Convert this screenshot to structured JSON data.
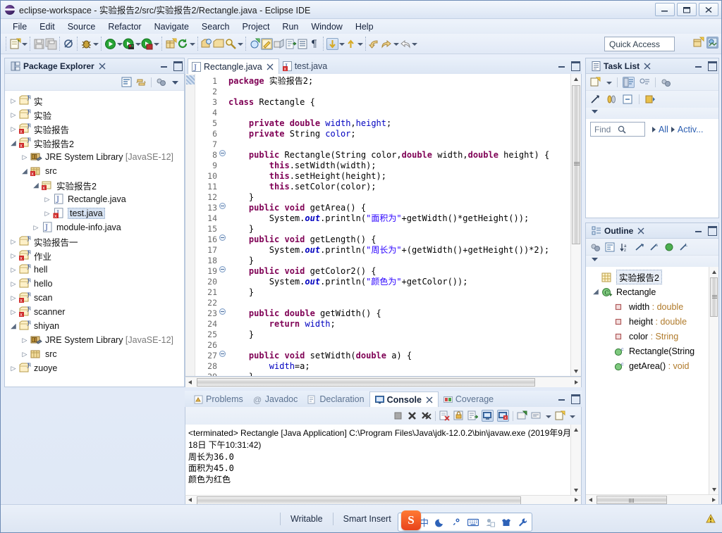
{
  "window": {
    "title": "eclipse-workspace - 实验报告2/src/实验报告2/Rectangle.java - Eclipse IDE",
    "minimize_label": "—",
    "maximize_label": "❐",
    "close_label": "✕"
  },
  "menubar": {
    "items": [
      "File",
      "Edit",
      "Source",
      "Refactor",
      "Navigate",
      "Search",
      "Project",
      "Run",
      "Window",
      "Help"
    ]
  },
  "toolbar": {
    "quick_access_placeholder": "Quick Access",
    "icons": [
      "new-wizard-icon",
      "new-dropdown-arrow",
      "save-icon",
      "save-all-icon",
      "toggle-breakpoint-icon",
      "debug-icon",
      "debug-dropdown-arrow",
      "run-icon",
      "run-dropdown-arrow",
      "run-coverage-icon",
      "coverage-dropdown-arrow",
      "external-tools-icon",
      "external-tools-dropdown-arrow",
      "new-java-package-icon",
      "refresh-icon",
      "refresh-dropdown-arrow",
      "open-type-icon",
      "open-task-icon",
      "search-icon",
      "search-dropdown-arrow",
      "new-java-class-icon",
      "java-editor-icon",
      "link-with-editor-icon",
      "open-declaration-icon",
      "show-whitespace-icon",
      "paragraph-mark-icon",
      "next-annotation-icon",
      "next-annotation-arrow",
      "previous-annotation-icon",
      "previous-annotation-arrow",
      "back-icon",
      "forward-icon",
      "forward-dropdown-arrow",
      "next-edit-icon",
      "next-edit-arrow"
    ],
    "perspective_icons": [
      "open-perspective-icon",
      "java-perspective-icon"
    ]
  },
  "package_explorer": {
    "title": "Package Explorer",
    "close_label": "✕",
    "toolbar_icons": [
      "collapse-all-icon",
      "link-with-editor-icon",
      "focus-on-active-task-icon",
      "view-menu-icon"
    ],
    "tree": [
      {
        "depth": 0,
        "twist": "closed",
        "icon": "java-project-icon",
        "label": "实",
        "error": false
      },
      {
        "depth": 0,
        "twist": "closed",
        "icon": "java-project-icon",
        "label": "实验",
        "error": false
      },
      {
        "depth": 0,
        "twist": "closed",
        "icon": "java-project-icon",
        "label": "实验报告",
        "error": true
      },
      {
        "depth": 0,
        "twist": "open",
        "icon": "java-project-icon",
        "label": "实验报告2",
        "error": true
      },
      {
        "depth": 1,
        "twist": "closed",
        "icon": "jre-library-icon",
        "label": "JRE System Library",
        "suffix": "[JavaSE-12]"
      },
      {
        "depth": 1,
        "twist": "open",
        "icon": "source-folder-icon",
        "label": "src",
        "error": true
      },
      {
        "depth": 2,
        "twist": "open",
        "icon": "package-icon",
        "label": "实验报告2",
        "error": true
      },
      {
        "depth": 3,
        "twist": "closed",
        "icon": "java-file-icon",
        "label": "Rectangle.java",
        "error": false
      },
      {
        "depth": 3,
        "twist": "closed",
        "icon": "java-file-icon",
        "label": "test.java",
        "error": true,
        "selected": true
      },
      {
        "depth": 2,
        "twist": "closed",
        "icon": "java-file-icon",
        "label": "module-info.java",
        "error": false
      },
      {
        "depth": 0,
        "twist": "closed",
        "icon": "java-project-icon",
        "label": "实验报告一",
        "error": false
      },
      {
        "depth": 0,
        "twist": "closed",
        "icon": "java-project-icon",
        "label": "作业",
        "error": true
      },
      {
        "depth": 0,
        "twist": "closed",
        "icon": "java-project-icon",
        "label": "hell",
        "error": false
      },
      {
        "depth": 0,
        "twist": "closed",
        "icon": "java-project-icon",
        "label": "hello",
        "error": false
      },
      {
        "depth": 0,
        "twist": "closed",
        "icon": "java-project-icon",
        "label": "scan",
        "error": true
      },
      {
        "depth": 0,
        "twist": "closed",
        "icon": "java-project-icon",
        "label": "scanner",
        "error": true
      },
      {
        "depth": 0,
        "twist": "open",
        "icon": "java-project-icon",
        "label": "shiyan",
        "error": false
      },
      {
        "depth": 1,
        "twist": "closed",
        "icon": "jre-library-icon",
        "label": "JRE System Library",
        "suffix": "[JavaSE-12]"
      },
      {
        "depth": 1,
        "twist": "closed",
        "icon": "source-folder-icon",
        "label": "src",
        "error": false
      },
      {
        "depth": 0,
        "twist": "closed",
        "icon": "java-project-icon",
        "label": "zuoye",
        "error": false
      }
    ]
  },
  "editor": {
    "tabs": [
      {
        "label": "Rectangle.java",
        "active": true,
        "close_label": "✕",
        "icon": "java-file-icon"
      },
      {
        "label": "test.java",
        "active": false,
        "icon": "java-file-error-icon"
      }
    ],
    "first_line": 1,
    "lines": [
      {
        "n": 1,
        "fold": false,
        "tokens": [
          {
            "t": "package ",
            "c": "kw"
          },
          {
            "t": "实验报告2;",
            "c": ""
          }
        ]
      },
      {
        "n": 2,
        "fold": false,
        "tokens": []
      },
      {
        "n": 3,
        "fold": false,
        "tokens": [
          {
            "t": "class",
            "c": "kw"
          },
          {
            "t": " Rectangle {",
            "c": ""
          }
        ]
      },
      {
        "n": 4,
        "fold": false,
        "tokens": []
      },
      {
        "n": 5,
        "fold": false,
        "tokens": [
          {
            "t": "    ",
            "c": ""
          },
          {
            "t": "private double",
            "c": "kw"
          },
          {
            "t": " ",
            "c": ""
          },
          {
            "t": "width",
            "c": "fld"
          },
          {
            "t": ",",
            "c": ""
          },
          {
            "t": "height",
            "c": "fld"
          },
          {
            "t": ";",
            "c": ""
          }
        ]
      },
      {
        "n": 6,
        "fold": false,
        "tokens": [
          {
            "t": "    ",
            "c": ""
          },
          {
            "t": "private",
            "c": "kw"
          },
          {
            "t": " String ",
            "c": ""
          },
          {
            "t": "color",
            "c": "fld"
          },
          {
            "t": ";",
            "c": ""
          }
        ]
      },
      {
        "n": 7,
        "fold": false,
        "tokens": []
      },
      {
        "n": 8,
        "fold": true,
        "tokens": [
          {
            "t": "    ",
            "c": ""
          },
          {
            "t": "public",
            "c": "kw"
          },
          {
            "t": " Rectangle(String color,",
            "c": ""
          },
          {
            "t": "double",
            "c": "kw"
          },
          {
            "t": " width,",
            "c": ""
          },
          {
            "t": "double",
            "c": "kw"
          },
          {
            "t": " height) {",
            "c": ""
          }
        ]
      },
      {
        "n": 9,
        "fold": false,
        "tokens": [
          {
            "t": "        ",
            "c": ""
          },
          {
            "t": "this",
            "c": "kw"
          },
          {
            "t": ".setWidth(width);",
            "c": ""
          }
        ]
      },
      {
        "n": 10,
        "fold": false,
        "tokens": [
          {
            "t": "        ",
            "c": ""
          },
          {
            "t": "this",
            "c": "kw"
          },
          {
            "t": ".setHeight(height);",
            "c": ""
          }
        ]
      },
      {
        "n": 11,
        "fold": false,
        "tokens": [
          {
            "t": "        ",
            "c": ""
          },
          {
            "t": "this",
            "c": "kw"
          },
          {
            "t": ".setColor(color);",
            "c": ""
          }
        ]
      },
      {
        "n": 12,
        "fold": false,
        "tokens": [
          {
            "t": "    }",
            "c": ""
          }
        ]
      },
      {
        "n": 13,
        "fold": true,
        "tokens": [
          {
            "t": "    ",
            "c": ""
          },
          {
            "t": "public void",
            "c": "kw"
          },
          {
            "t": " getArea() {",
            "c": ""
          }
        ]
      },
      {
        "n": 14,
        "fold": false,
        "tokens": [
          {
            "t": "        System.",
            "c": ""
          },
          {
            "t": "out",
            "c": "stat"
          },
          {
            "t": ".println(",
            "c": ""
          },
          {
            "t": "\"面积为\"",
            "c": "str"
          },
          {
            "t": "+getWidth()*getHeight());",
            "c": ""
          }
        ]
      },
      {
        "n": 15,
        "fold": false,
        "tokens": [
          {
            "t": "    }",
            "c": ""
          }
        ]
      },
      {
        "n": 16,
        "fold": true,
        "tokens": [
          {
            "t": "    ",
            "c": ""
          },
          {
            "t": "public void",
            "c": "kw"
          },
          {
            "t": " getLength() {",
            "c": ""
          }
        ]
      },
      {
        "n": 17,
        "fold": false,
        "tokens": [
          {
            "t": "        System.",
            "c": ""
          },
          {
            "t": "out",
            "c": "stat"
          },
          {
            "t": ".println(",
            "c": ""
          },
          {
            "t": "\"周长为\"",
            "c": "str"
          },
          {
            "t": "+(getWidth()+getHeight())*2);",
            "c": ""
          }
        ]
      },
      {
        "n": 18,
        "fold": false,
        "tokens": [
          {
            "t": "    }",
            "c": ""
          }
        ]
      },
      {
        "n": 19,
        "fold": true,
        "tokens": [
          {
            "t": "    ",
            "c": ""
          },
          {
            "t": "public void",
            "c": "kw"
          },
          {
            "t": " getColor2() {",
            "c": ""
          }
        ]
      },
      {
        "n": 20,
        "fold": false,
        "tokens": [
          {
            "t": "        System.",
            "c": ""
          },
          {
            "t": "out",
            "c": "stat"
          },
          {
            "t": ".println(",
            "c": ""
          },
          {
            "t": "\"颜色为\"",
            "c": "str"
          },
          {
            "t": "+getColor());",
            "c": ""
          }
        ]
      },
      {
        "n": 21,
        "fold": false,
        "tokens": [
          {
            "t": "    }",
            "c": ""
          }
        ]
      },
      {
        "n": 22,
        "fold": false,
        "tokens": []
      },
      {
        "n": 23,
        "fold": true,
        "tokens": [
          {
            "t": "    ",
            "c": ""
          },
          {
            "t": "public double",
            "c": "kw"
          },
          {
            "t": " getWidth() {",
            "c": ""
          }
        ]
      },
      {
        "n": 24,
        "fold": false,
        "tokens": [
          {
            "t": "        ",
            "c": ""
          },
          {
            "t": "return",
            "c": "kw"
          },
          {
            "t": " ",
            "c": ""
          },
          {
            "t": "width",
            "c": "fld"
          },
          {
            "t": ";",
            "c": ""
          }
        ]
      },
      {
        "n": 25,
        "fold": false,
        "tokens": [
          {
            "t": "    }",
            "c": ""
          }
        ]
      },
      {
        "n": 26,
        "fold": false,
        "tokens": []
      },
      {
        "n": 27,
        "fold": true,
        "tokens": [
          {
            "t": "    ",
            "c": ""
          },
          {
            "t": "public void",
            "c": "kw"
          },
          {
            "t": " setWidth(",
            "c": ""
          },
          {
            "t": "double",
            "c": "kw"
          },
          {
            "t": " a) {",
            "c": ""
          }
        ]
      },
      {
        "n": 28,
        "fold": false,
        "tokens": [
          {
            "t": "        ",
            "c": ""
          },
          {
            "t": "width",
            "c": "fld"
          },
          {
            "t": "=a;",
            "c": ""
          }
        ]
      },
      {
        "n": 29,
        "fold": false,
        "tokens": [
          {
            "t": "    }",
            "c": ""
          }
        ]
      }
    ]
  },
  "task_list": {
    "title": "Task List",
    "close_label": "✕",
    "toolbar_icons": [
      "new-task-icon",
      "new-task-dropdown",
      "categorized-icon",
      "scheduled-icon",
      "focus-on-workweek-icon"
    ],
    "toolbar_icons2": [
      "synchronize-icon",
      "collapse-all-icon",
      "restore-icon",
      "task-repositories-icon",
      "view-menu-icon"
    ],
    "find_placeholder": "Find",
    "filter_all": "All",
    "filter_activate": "Activ..."
  },
  "outline": {
    "title": "Outline",
    "close_label": "✕",
    "toolbar_icons": [
      "focus-on-active-task-icon",
      "collapse-all-icon",
      "sort-icon",
      "hide-fields-icon",
      "hide-static-icon",
      "hide-nonpublic-icon",
      "hide-local-types-icon",
      "view-menu-icon"
    ],
    "items": [
      {
        "depth": 0,
        "twist": "none",
        "icon": "package-declaration-icon",
        "label": "实验报告2",
        "type": "",
        "selected": true
      },
      {
        "depth": 0,
        "twist": "open",
        "icon": "class-icon",
        "label": "Rectangle",
        "type": ""
      },
      {
        "depth": 1,
        "twist": "none",
        "icon": "private-field-icon",
        "label": "width",
        "type": " : double"
      },
      {
        "depth": 1,
        "twist": "none",
        "icon": "private-field-icon",
        "label": "height",
        "type": " : double"
      },
      {
        "depth": 1,
        "twist": "none",
        "icon": "private-field-icon",
        "label": "color",
        "type": " : String"
      },
      {
        "depth": 1,
        "twist": "none",
        "icon": "public-method-icon",
        "label": "Rectangle(String",
        "type": ""
      },
      {
        "depth": 1,
        "twist": "none",
        "icon": "public-method-icon",
        "label": "getArea()",
        "type": " : void"
      }
    ]
  },
  "console": {
    "tabs": [
      {
        "label": "Problems",
        "active": false,
        "icon": "problems-icon"
      },
      {
        "label": "Javadoc",
        "active": false,
        "icon": "javadoc-icon"
      },
      {
        "label": "Declaration",
        "active": false,
        "icon": "declaration-icon"
      },
      {
        "label": "Console",
        "active": true,
        "close_label": "✕",
        "icon": "console-icon"
      },
      {
        "label": "Coverage",
        "active": false,
        "icon": "coverage-icon"
      }
    ],
    "toolbar_icons": [
      "terminate-icon",
      "remove-launch-icon",
      "remove-all-terminated-icon",
      "clear-console-icon",
      "scroll-lock-icon",
      "word-wrap-icon",
      "show-console-on-output-icon",
      "show-console-on-error-icon",
      "pin-console-icon",
      "display-selected-console-icon",
      "display-dropdown-arrow",
      "open-console-icon",
      "open-console-dropdown-arrow"
    ],
    "header": "<terminated> Rectangle [Java Application] C:\\Program Files\\Java\\jdk-12.0.2\\bin\\javaw.exe (2019年9月18日 下午10:31:42)",
    "output": [
      "周长为36.0",
      "面积为45.0",
      "颜色为红色"
    ]
  },
  "statusbar": {
    "writable": "Writable",
    "insert_mode": "Smart Insert",
    "position": ""
  },
  "ime": {
    "logo": "S",
    "items": [
      "中",
      "☽",
      "°,",
      "⌨",
      "🗂",
      "👕",
      "🔧"
    ],
    "item_names": [
      "chinese-mode-icon",
      "moon-icon",
      "punctuation-icon",
      "soft-keyboard-icon",
      "user-dict-icon",
      "skin-icon",
      "settings-icon"
    ]
  },
  "colors": {
    "accent": "#2a5db0",
    "keyword": "#7f0055",
    "string": "#2a00ff",
    "field": "#0000c0",
    "chrome": "#dfe8f6"
  }
}
